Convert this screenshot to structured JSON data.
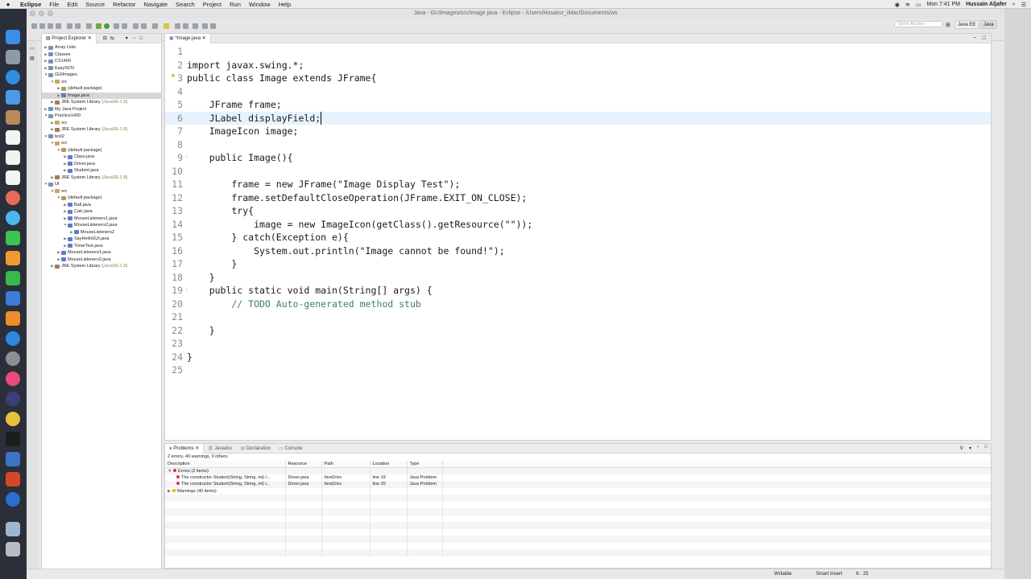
{
  "menubar": {
    "app": "Eclipse",
    "items": [
      "File",
      "Edit",
      "Source",
      "Refactor",
      "Navigate",
      "Search",
      "Project",
      "Run",
      "Window",
      "Help"
    ],
    "clock": "Mon 7:41 PM",
    "user": "Hussain Aljafer"
  },
  "window": {
    "title": "Java - GUIImages/src/Image.java - Eclipse - /Users/Husainz_iMac/Documents/ws",
    "quick_access_placeholder": "Quick Access",
    "perspectives": [
      "Java EE",
      "Java"
    ]
  },
  "explorer": {
    "tabs": [
      "Project Explorer"
    ],
    "tree": [
      {
        "label": "Array Lists",
        "type": "proj",
        "depth": 0,
        "twisty": "▶"
      },
      {
        "label": "Classes",
        "type": "proj",
        "depth": 0,
        "twisty": "▶"
      },
      {
        "label": "CS1400",
        "type": "proj",
        "depth": 0,
        "twisty": "▶"
      },
      {
        "label": "EasySCN",
        "type": "proj",
        "depth": 0,
        "twisty": "▶"
      },
      {
        "label": "GUIImages",
        "type": "proj",
        "depth": 0,
        "twisty": "▼"
      },
      {
        "label": "src",
        "type": "src",
        "depth": 1,
        "twisty": "▼"
      },
      {
        "label": "(default package)",
        "type": "pkg",
        "depth": 2,
        "twisty": "▶"
      },
      {
        "label": "Image.java",
        "type": "java",
        "depth": 2,
        "twisty": "▶",
        "selected": true
      },
      {
        "label": "JRE System Library",
        "version": "[JavaSE-1.8]",
        "type": "lib",
        "depth": 1,
        "twisty": "▶"
      },
      {
        "label": "My Java Project",
        "type": "proj",
        "depth": 0,
        "twisty": "▶"
      },
      {
        "label": "Practice1400",
        "type": "proj",
        "depth": 0,
        "twisty": "▼"
      },
      {
        "label": "src",
        "type": "src",
        "depth": 1,
        "twisty": "▶"
      },
      {
        "label": "JRE System Library",
        "version": "[JavaSE-1.8]",
        "type": "lib",
        "depth": 1,
        "twisty": "▶"
      },
      {
        "label": "test2",
        "type": "proj",
        "depth": 0,
        "twisty": "▼"
      },
      {
        "label": "src",
        "type": "src",
        "depth": 1,
        "twisty": "▼"
      },
      {
        "label": "(default package)",
        "type": "pkg",
        "depth": 2,
        "twisty": "▼"
      },
      {
        "label": "Class.java",
        "type": "java",
        "depth": 3,
        "twisty": "▶"
      },
      {
        "label": "Driver.java",
        "type": "java",
        "depth": 3,
        "twisty": "▶"
      },
      {
        "label": "Student.java",
        "type": "java",
        "depth": 3,
        "twisty": "▶"
      },
      {
        "label": "JRE System Library",
        "version": "[JavaSE-1.8]",
        "type": "lib",
        "depth": 1,
        "twisty": "▶"
      },
      {
        "label": "UI",
        "type": "proj",
        "depth": 0,
        "twisty": "▼"
      },
      {
        "label": "src",
        "type": "src",
        "depth": 1,
        "twisty": "▼"
      },
      {
        "label": "(default package)",
        "type": "pkg",
        "depth": 2,
        "twisty": "▼"
      },
      {
        "label": "Ball.java",
        "type": "java",
        "depth": 3,
        "twisty": "▶"
      },
      {
        "label": "Calc.java",
        "type": "java",
        "depth": 3,
        "twisty": "▶"
      },
      {
        "label": "MouseListeners1.java",
        "type": "java",
        "depth": 3,
        "twisty": "▶"
      },
      {
        "label": "MouseListeners2.java",
        "type": "java",
        "depth": 3,
        "twisty": "▼"
      },
      {
        "label": "MouseListeners2",
        "type": "java",
        "depth": 4,
        "twisty": "▶"
      },
      {
        "label": "SayHelloGUI.java",
        "type": "java",
        "depth": 3,
        "twisty": "▶"
      },
      {
        "label": "TimerTest.java",
        "type": "java",
        "depth": 3,
        "twisty": "▶"
      },
      {
        "label": "MouseListeners1.java",
        "type": "java",
        "depth": 2,
        "twisty": "▶"
      },
      {
        "label": "MouseListeners2.java",
        "type": "java",
        "depth": 2,
        "twisty": "▶"
      },
      {
        "label": "JRE System Library",
        "version": "[JavaSE-1.8]",
        "type": "lib",
        "depth": 1,
        "twisty": "▶"
      }
    ]
  },
  "editor": {
    "tab_label": "*Image.java",
    "lines": [
      {
        "num": "1",
        "text": ""
      },
      {
        "num": "2",
        "text": "import javax.swing.*;"
      },
      {
        "num": "3",
        "text": "public class Image extends JFrame{",
        "warn": true
      },
      {
        "num": "4",
        "text": ""
      },
      {
        "num": "5",
        "text": "    JFrame frame;"
      },
      {
        "num": "6",
        "text": "    JLabel displayField;",
        "current": true
      },
      {
        "num": "7",
        "text": "    ImageIcon image;"
      },
      {
        "num": "8",
        "text": ""
      },
      {
        "num": "9",
        "text": "    public Image(){",
        "mark": true
      },
      {
        "num": "10",
        "text": ""
      },
      {
        "num": "11",
        "text": "        frame = new JFrame(\"Image Display Test\");"
      },
      {
        "num": "12",
        "text": "        frame.setDefaultCloseOperation(JFrame.EXIT_ON_CLOSE);"
      },
      {
        "num": "13",
        "text": "        try{"
      },
      {
        "num": "14",
        "text": "            image = new ImageIcon(getClass().getResource(\"\"));"
      },
      {
        "num": "15",
        "text": "        } catch(Exception e){"
      },
      {
        "num": "16",
        "text": "            System.out.println(\"Image cannot be found!\");"
      },
      {
        "num": "17",
        "text": "        }"
      },
      {
        "num": "18",
        "text": "    }"
      },
      {
        "num": "19",
        "text": "    public static void main(String[] args) {",
        "mark": true
      },
      {
        "num": "20",
        "text": "        // TODO Auto-generated method stub",
        "comment": true
      },
      {
        "num": "21",
        "text": ""
      },
      {
        "num": "22",
        "text": "    }"
      },
      {
        "num": "23",
        "text": ""
      },
      {
        "num": "24",
        "text": "}"
      },
      {
        "num": "25",
        "text": ""
      }
    ]
  },
  "problems": {
    "tabs": [
      "Problems",
      "Javadoc",
      "Declaration",
      "Console"
    ],
    "summary": "2 errors, 40 warnings, 0 others",
    "columns": [
      "Description",
      "Resource",
      "Path",
      "Location",
      "Type"
    ],
    "errors_group": "Errors (2 items)",
    "rows": [
      {
        "description": "The constructor Student(String, String, int) i...",
        "resource": "Driver.java",
        "path": "/test2/src",
        "location": "line 19",
        "type": "Java Problem"
      },
      {
        "description": "The constructor Student(String, String, int) i...",
        "resource": "Driver.java",
        "path": "/test2/src",
        "location": "line 20",
        "type": "Java Problem"
      }
    ],
    "warnings_group": "Warnings (40 items)"
  },
  "status": {
    "writable": "Writable",
    "insert_mode": "Smart Insert",
    "position": "6 : 25"
  },
  "colors": {
    "keyword": "#1a1a1a",
    "field": "#0000c0",
    "string": "#2a00ff",
    "comment": "#3f7f5f",
    "current_line": "#e8f2fe"
  }
}
